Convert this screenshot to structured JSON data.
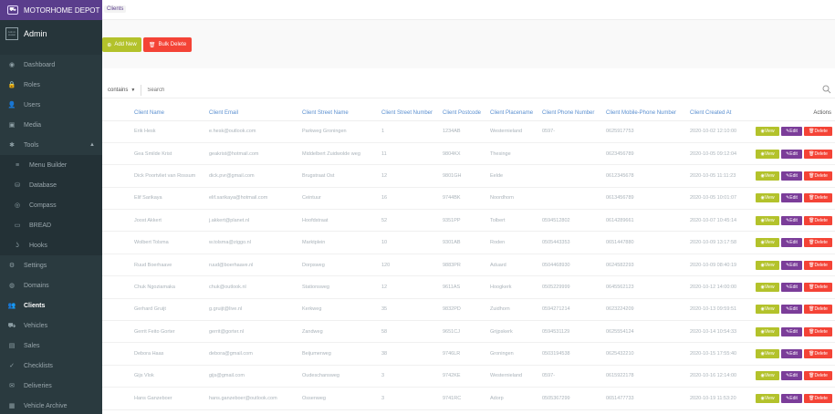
{
  "brand": {
    "title": "MOTORHOME DEPOT"
  },
  "profile": {
    "avatar_alt": "Admin avatar",
    "name": "Admin"
  },
  "breadcrumb": "Clients",
  "actions": {
    "add_new": "Add New",
    "bulk_delete": "Bulk Delete"
  },
  "search": {
    "filter": "contains",
    "placeholder": "Search"
  },
  "sidebar": {
    "items": [
      {
        "label": "Dashboard",
        "icon": "dashboard-icon",
        "glyph": "◉"
      },
      {
        "label": "Roles",
        "icon": "lock-icon",
        "glyph": "🔒"
      },
      {
        "label": "Users",
        "icon": "user-icon",
        "glyph": "👤"
      },
      {
        "label": "Media",
        "icon": "image-icon",
        "glyph": "▣"
      },
      {
        "label": "Tools",
        "icon": "tools-icon",
        "glyph": "✱"
      },
      {
        "label": "Menu Builder",
        "icon": "list-icon",
        "glyph": "≡"
      },
      {
        "label": "Database",
        "icon": "database-icon",
        "glyph": "⛁"
      },
      {
        "label": "Compass",
        "icon": "compass-icon",
        "glyph": "◎"
      },
      {
        "label": "BREAD",
        "icon": "bread-icon",
        "glyph": "▭"
      },
      {
        "label": "Hooks",
        "icon": "hook-icon",
        "glyph": "ʖ"
      },
      {
        "label": "Settings",
        "icon": "settings-icon",
        "glyph": "⚙"
      },
      {
        "label": "Domains",
        "icon": "globe-icon",
        "glyph": "◍"
      },
      {
        "label": "Clients",
        "icon": "people-icon",
        "glyph": "👥"
      },
      {
        "label": "Vehicles",
        "icon": "car-icon",
        "glyph": "⛟"
      },
      {
        "label": "Sales",
        "icon": "document-icon",
        "glyph": "▤"
      },
      {
        "label": "Checklists",
        "icon": "check-icon",
        "glyph": "✓"
      },
      {
        "label": "Deliveries",
        "icon": "mail-icon",
        "glyph": "✉"
      },
      {
        "label": "Vehicle Archive",
        "icon": "archive-icon",
        "glyph": "▦"
      }
    ]
  },
  "table": {
    "columns": [
      "Client Name",
      "Client Email",
      "Client Street Name",
      "Client Street Number",
      "Client Postcode",
      "Client Placename",
      "Client Phone Number",
      "Client Mobile-Phone Number",
      "Client Created At",
      "Actions"
    ],
    "buttons": {
      "view": "View",
      "edit": "Edit",
      "delete": "Delete"
    },
    "rows": [
      [
        "Erik Hesk",
        "e.hesk@outlook.com",
        "Parkweg Groningen",
        "1",
        "1234AB",
        "Westernieland",
        "0597-",
        "0625917753",
        "2020-10-02 12:10:00"
      ],
      [
        "Gea Smilde Krist",
        "geakrist@hotmail.com",
        "Middelbert Zuidwolde weg",
        "11",
        "9804KX",
        "Thesinge",
        "",
        "0623456789",
        "2020-10-05 09:12:04"
      ],
      [
        "Dick Poortvliet van Rossum",
        "dick.pvr@gmail.com",
        "Brugstraat Ost",
        "12",
        "9801GH",
        "Eelde",
        "",
        "0612345678",
        "2020-10-05 11:11:23"
      ],
      [
        "Elif Sarikaya",
        "elif.sarikaya@hotmail.com",
        "Ceintuur",
        "16",
        "9744BK",
        "Noordhorn",
        "",
        "0613456789",
        "2020-10-05 10:01:07"
      ],
      [
        "Joost Akkert",
        "j.akkert@planet.nl",
        "Hoofdstraat",
        "52",
        "9351PP",
        "Tolbert",
        "0594512802",
        "0614289661",
        "2020-10-07 10:45:14"
      ],
      [
        "Wolbert Tolsma",
        "w.tolsma@ziggo.nl",
        "Marktplein",
        "10",
        "9301AB",
        "Roden",
        "0505443353",
        "0651447880",
        "2020-10-09 13:17:58"
      ],
      [
        "Ruud Boerhaave",
        "ruud@boerhaave.nl",
        "Dorpsweg",
        "120",
        "9883PR",
        "Aduard",
        "0504468930",
        "0624582293",
        "2020-10-09 08:40:19"
      ],
      [
        "Chuk Ngoziamaka",
        "chuk@outlook.nl",
        "Stationsweg",
        "12",
        "9611AS",
        "Hoogkerk",
        "0505229999",
        "0645562123",
        "2020-10-12 14:00:00"
      ],
      [
        "Gerhard Gruijt",
        "g.gruijt@live.nl",
        "Kerkweg",
        "35",
        "9832PD",
        "Zuidhorn",
        "0594271214",
        "0623224209",
        "2020-10-13 09:59:51"
      ],
      [
        "Gerrit Feito Gorter",
        "gerrit@gorter.nl",
        "Zandweg",
        "58",
        "9651CJ",
        "Grijpskerk",
        "0594531129",
        "0625554124",
        "2020-10-14 10:54:33"
      ],
      [
        "Debora Haas",
        "debora@gmail.com",
        "Beijumerweg",
        "38",
        "9746LR",
        "Groningen",
        "0503194538",
        "0625432210",
        "2020-10-15 17:55:40"
      ],
      [
        "Gijs Vlok",
        "gijs@gmail.com",
        "Oudeschansweg",
        "3",
        "9742KE",
        "Westernieland",
        "0597-",
        "0615922178",
        "2020-10-16 12:14:00"
      ],
      [
        "Hans Ganzeboer",
        "hans.ganzeboer@outlook.com",
        "Ossenweg",
        "3",
        "9741RC",
        "Adorp",
        "0505367299",
        "0651477733",
        "2020-10-19 11:53:20"
      ]
    ]
  }
}
